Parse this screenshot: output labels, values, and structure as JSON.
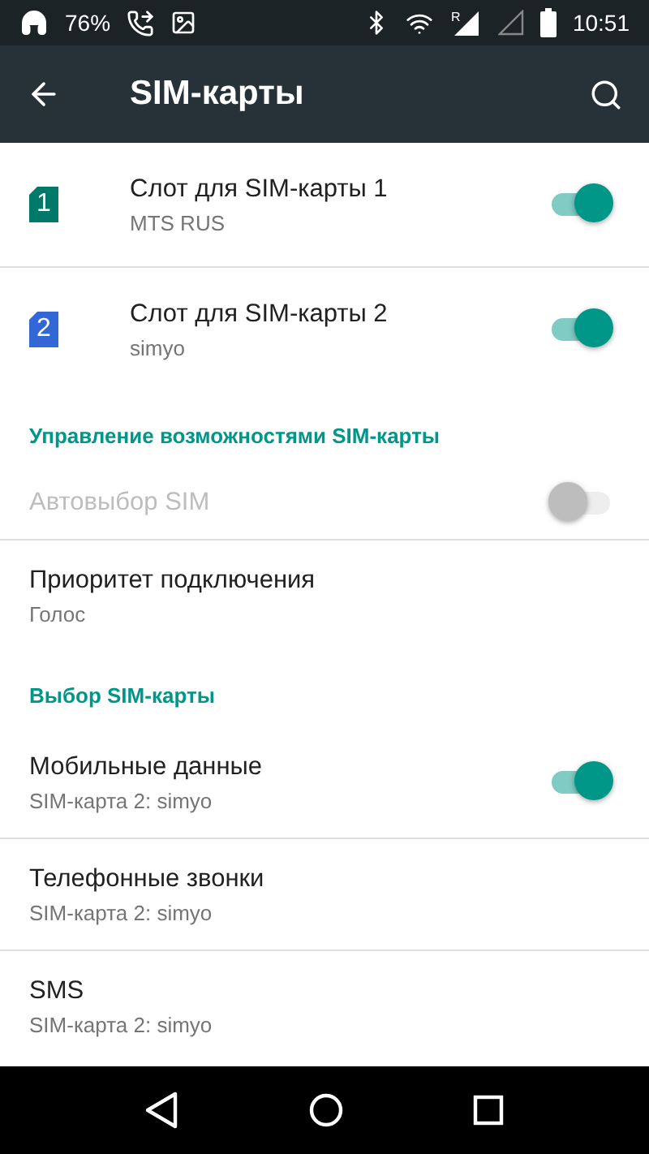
{
  "status_bar": {
    "battery_percent": "76%",
    "roaming": "R",
    "time": "10:51"
  },
  "app_bar": {
    "title": "SIM-карты"
  },
  "items": [
    {
      "kind": "sim",
      "number": "1",
      "color": "#00796b",
      "title": "Слот для SIM-карты 1",
      "subtitle": "MTS RUS",
      "switch": {
        "on": true
      },
      "divider": true
    },
    {
      "kind": "sim",
      "number": "2",
      "color": "#3367d6",
      "title": "Слот для SIM-карты 2",
      "subtitle": "simyo",
      "switch": {
        "on": true
      },
      "divider": false
    },
    {
      "kind": "header",
      "title": "Управление возможностями SIM-карты"
    },
    {
      "kind": "setting",
      "title": "Автовыбор SIM",
      "disabled": true,
      "switch": {
        "on": false
      },
      "divider": true
    },
    {
      "kind": "setting",
      "title": "Приоритет подключения",
      "subtitle": "Голос",
      "disabled": false,
      "divider": false
    },
    {
      "kind": "header",
      "title": "Выбор SIM-карты"
    },
    {
      "kind": "setting",
      "title": "Мобильные данные",
      "subtitle": "SIM-карта 2: simyo",
      "disabled": false,
      "switch": {
        "on": true
      },
      "divider": true
    },
    {
      "kind": "setting",
      "title": "Телефонные звонки",
      "subtitle": "SIM-карта 2: simyo",
      "disabled": false,
      "divider": true
    },
    {
      "kind": "setting",
      "title": "SMS",
      "subtitle": "SIM-карта 2: simyo",
      "disabled": false,
      "divider": false
    }
  ]
}
